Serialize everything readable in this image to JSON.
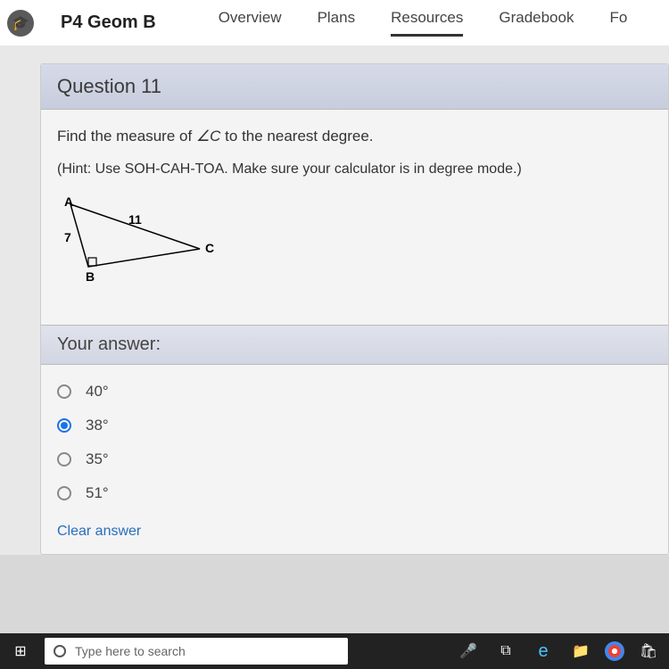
{
  "nav": {
    "course": "P4 Geom B",
    "tabs": [
      "Overview",
      "Plans",
      "Resources",
      "Gradebook",
      "Fo"
    ],
    "activeTab": 2
  },
  "question": {
    "title": "Question 11",
    "prompt_pre": "Find the measure of ",
    "prompt_angle": "∠C",
    "prompt_post": " to the nearest degree.",
    "hint": "(Hint: Use SOH-CAH-TOA. Make sure your calculator is in degree mode.)",
    "triangle": {
      "A": "A",
      "B": "B",
      "C": "C",
      "hypotenuse": "11",
      "opposite": "7"
    },
    "answer_header": "Your answer:",
    "options": [
      "40°",
      "38°",
      "35°",
      "51°"
    ],
    "selected": 1,
    "clear": "Clear answer"
  },
  "taskbar": {
    "search_placeholder": "Type here to search"
  }
}
